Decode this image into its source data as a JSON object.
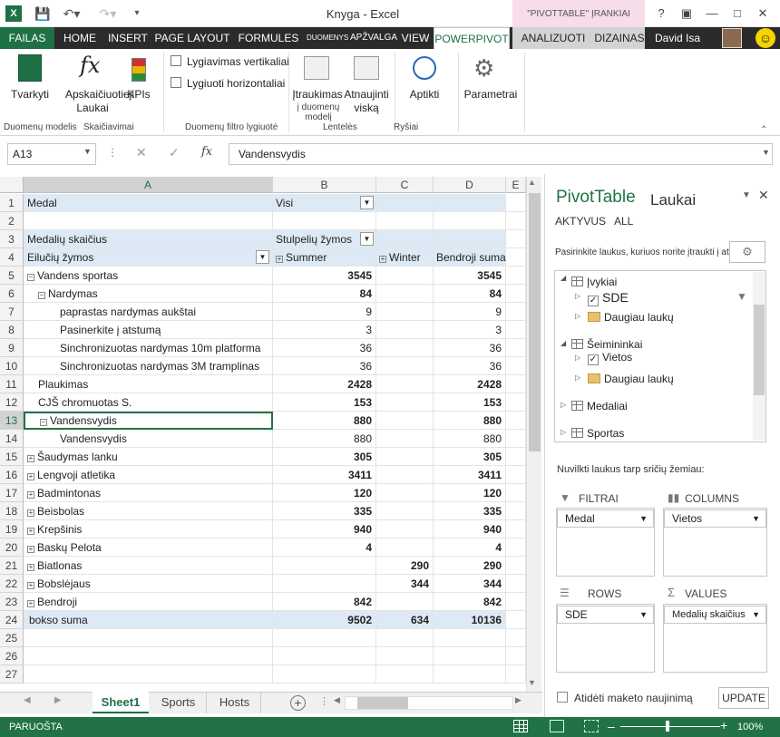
{
  "window": {
    "title": "Knyga - Excel",
    "context_tab": "\"PIVOTTABLE\" ĮRANKIAI",
    "user": "David Isa"
  },
  "tabs": [
    "FAILAS",
    "HOME",
    "INSERT",
    "PAGE LAYOUT",
    "FORMULES",
    "DUOMENYS",
    "APŽVALGA",
    "VIEW",
    "POWERPIVOT",
    "ANALIZUOTI",
    "DIZAINAS"
  ],
  "ribbon": {
    "tvarkyti": "Tvarkyti",
    "apskaiciuotieji": "Apskaičiuotieji",
    "laukai": "Laukai",
    "kpis": "KPIs",
    "lyg_vert": "Lygiavimas vertikaliai",
    "lyg_hor": "Lygiuoti horizontaliai",
    "itraukimas": "Įtraukimas",
    "i_duomenu": "į duomenų modelį",
    "atnaujinti": "Atnaujinti",
    "viska": "viską",
    "aptikti": "Aptikti",
    "parametrai": "Parametrai",
    "groups": [
      "Duomenų modelis",
      "Skaičiavimai",
      "Duomenų filtro lygiuotė",
      "Lentelės",
      "Ryšiai"
    ]
  },
  "formula": {
    "namebox": "A13",
    "content": "Vandensvydis"
  },
  "columns": [
    "A",
    "B",
    "C",
    "D",
    "E"
  ],
  "rows": [
    {
      "n": "1",
      "a": "Medal",
      "b": "Visi"
    },
    {
      "n": "2"
    },
    {
      "n": "3",
      "a": "Medalių skaičius",
      "b": "Stulpelių žymos"
    },
    {
      "n": "4",
      "a": "Eilučių žymos",
      "b": "Summer",
      "c": "Winter",
      "d": "Bendroji suma"
    },
    {
      "n": "5",
      "a": "Vandens sportas",
      "b": "3545",
      "d": "3545"
    },
    {
      "n": "6",
      "a": "Nardymas",
      "b": "84",
      "d": "84"
    },
    {
      "n": "7",
      "a": "paprastas nardymas aukštai",
      "b": "9",
      "d": "9"
    },
    {
      "n": "8",
      "a": "Pasinerkite į atstumą",
      "b": "3",
      "d": "3"
    },
    {
      "n": "9",
      "a": "Sinchronizuotas nardymas 10m platforma",
      "b": "36",
      "d": "36"
    },
    {
      "n": "10",
      "a": "Sinchronizuotas nardymas 3M tramplinas",
      "b": "36",
      "d": "36"
    },
    {
      "n": "11",
      "a": "Plaukimas",
      "b": "2428",
      "d": "2428"
    },
    {
      "n": "12",
      "a": "CJŠ chromuotas S.",
      "b": "153",
      "d": "153"
    },
    {
      "n": "13",
      "a": "Vandensvydis",
      "b": "880",
      "d": "880"
    },
    {
      "n": "14",
      "a": "Vandensvydis",
      "b": "880",
      "d": "880"
    },
    {
      "n": "15",
      "a": "Šaudymas lanku",
      "b": "305",
      "d": "305"
    },
    {
      "n": "16",
      "a": "Lengvoji atletika",
      "b": "3411",
      "d": "3411"
    },
    {
      "n": "17",
      "a": "Badmintonas",
      "b": "120",
      "d": "120"
    },
    {
      "n": "18",
      "a": "Beisbolas",
      "b": "335",
      "d": "335"
    },
    {
      "n": "19",
      "a": "Krepšinis",
      "b": "940",
      "d": "940"
    },
    {
      "n": "20",
      "a": "Baskų Pelota",
      "b": "4",
      "d": "4"
    },
    {
      "n": "21",
      "a": "Biatlonas",
      "c": "290",
      "d": "290"
    },
    {
      "n": "22",
      "a": "Bobslėjaus",
      "c": "344",
      "d": "344"
    },
    {
      "n": "23",
      "a": "Bendroji",
      "b": "842",
      "d": "842"
    },
    {
      "n": "24",
      "a": "bokso suma",
      "b": "9502",
      "c": "634",
      "d": "10136"
    },
    {
      "n": "25"
    },
    {
      "n": "26"
    },
    {
      "n": "27"
    }
  ],
  "sheets": [
    "Sheet1",
    "Sports",
    "Hosts"
  ],
  "status": {
    "left": "PARUOŠTA",
    "zoom": "100%"
  },
  "pane": {
    "title1": "PivotTable",
    "title2": "Laukai",
    "tab_active": "AKTYVUS",
    "tab_all": "ALL",
    "instruction": "Pasirinkite laukus, kuriuos norite įtraukti į ataskaitą:",
    "tree": [
      "Įvykiai",
      "SDE",
      "Daugiau laukų",
      "Šeimininkai",
      "Vietos",
      "Daugiau laukų",
      "Medaliai",
      "Sportas"
    ],
    "drag_hint": "Nuvilkti laukus tarp sričių žemiau:",
    "areas": {
      "filters": "FILTRAI",
      "columns": "COLUMNS",
      "rows": "ROWS",
      "values": "VALUES"
    },
    "filters_value": "Medal",
    "columns_value": "Vietos",
    "rows_value": "SDE",
    "values_value": "Medalių skaičius",
    "defer": "Atidėti maketo naujinimą",
    "update": "UPDATE"
  }
}
